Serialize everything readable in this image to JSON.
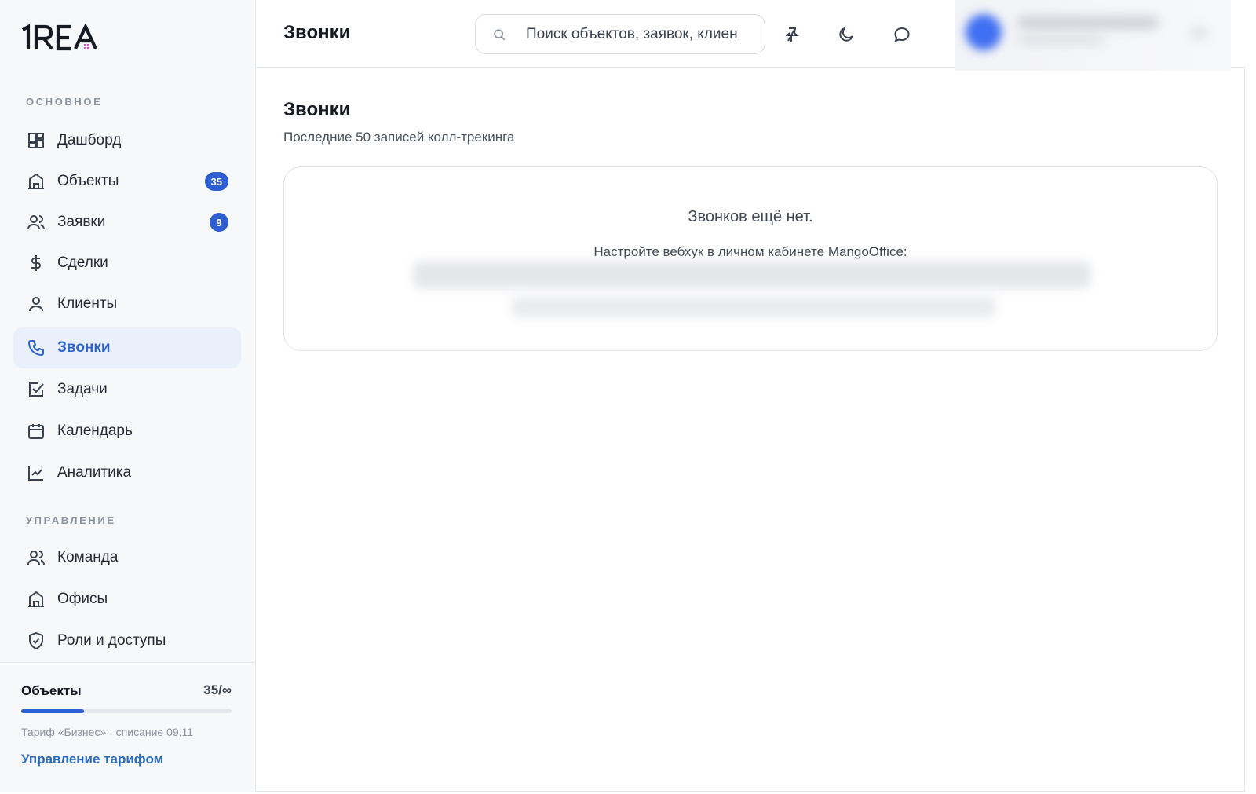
{
  "app": {
    "logo_text": "1REA"
  },
  "sidebar": {
    "section_main": "ОСНОВНОЕ",
    "section_admin": "УПРАВЛЕНИЕ",
    "items": [
      {
        "label": "Дашборд",
        "icon": "dashboard-icon"
      },
      {
        "label": "Объекты",
        "icon": "building-icon",
        "badge": "35"
      },
      {
        "label": "Заявки",
        "icon": "users-icon",
        "badge": "9"
      },
      {
        "label": "Сделки",
        "icon": "dollar-icon"
      },
      {
        "label": "Клиенты",
        "icon": "user-icon"
      },
      {
        "label": "Звонки",
        "icon": "phone-icon",
        "active": true
      },
      {
        "label": "Задачи",
        "icon": "checkbox-icon"
      },
      {
        "label": "Календарь",
        "icon": "calendar-icon"
      },
      {
        "label": "Аналитика",
        "icon": "chart-icon"
      }
    ],
    "admin_items": [
      {
        "label": "Команда",
        "icon": "team-icon"
      },
      {
        "label": "Офисы",
        "icon": "office-icon"
      },
      {
        "label": "Роли и доступы",
        "icon": "shield-icon"
      }
    ],
    "footer": {
      "quota_label": "Объекты",
      "quota_value": "35/∞",
      "quota_fraction": 0.3,
      "plan_text": "Тариф «Бизнес» · списание 09.11",
      "plan_link": "Управление тарифом"
    }
  },
  "header": {
    "title": "Звонки",
    "search_placeholder": "Поиск объектов, заявок, клиентов"
  },
  "main": {
    "title": "Звонки",
    "subtitle": "Последние 50 записей колл-трекинга",
    "empty_title": "Звонков ещё нет.",
    "empty_hint": "Настройте вебхук в личном кабинете MangoOffice:"
  },
  "colors": {
    "accent": "#2d5fd0",
    "active_bg": "#e9f0fc",
    "link": "#2d6ab8"
  }
}
